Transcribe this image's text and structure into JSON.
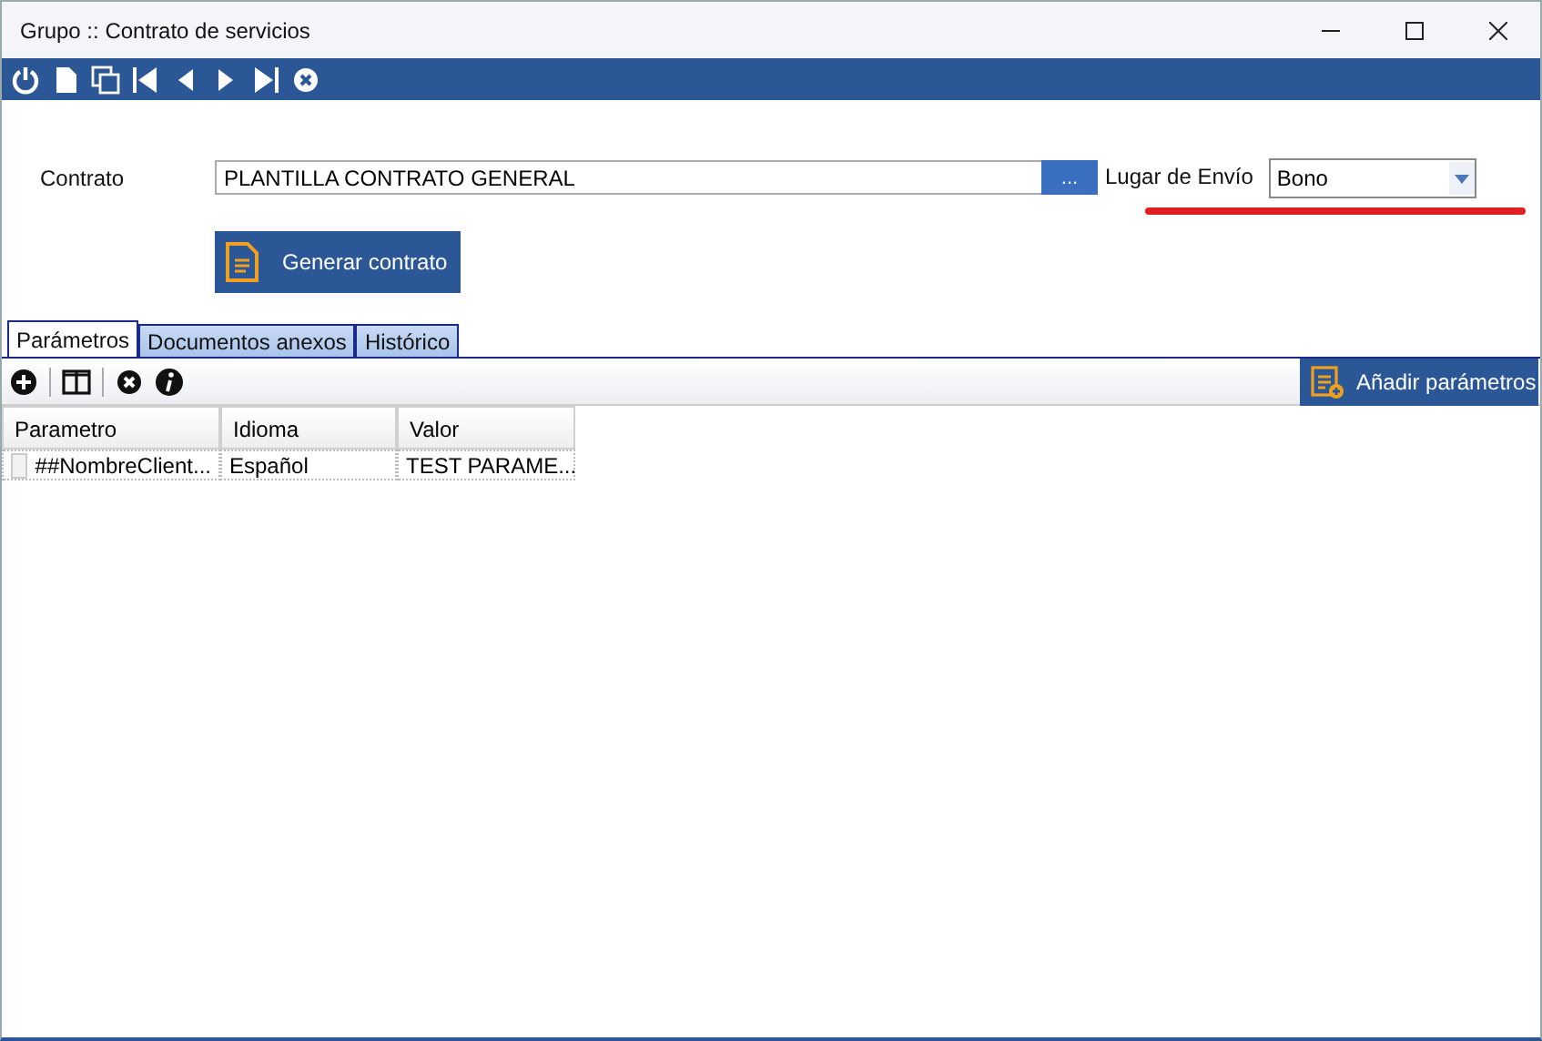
{
  "window": {
    "title": "Grupo :: Contrato de servicios"
  },
  "toolbar": [
    {
      "kind": "power"
    },
    {
      "kind": "new"
    },
    {
      "kind": "copy"
    },
    {
      "kind": "first"
    },
    {
      "kind": "prev"
    },
    {
      "kind": "next"
    },
    {
      "kind": "last"
    },
    {
      "kind": "cancel"
    }
  ],
  "contrato": {
    "label": "Contrato",
    "value": "PLANTILLA CONTRATO GENERAL",
    "browse": "..."
  },
  "generate_button": "Generar contrato",
  "lugar_envio": {
    "label": "Lugar de Envío",
    "value": "Bono",
    "highlighted": true
  },
  "tabs": [
    {
      "label": "Parámetros",
      "selected": true
    },
    {
      "label": "Documentos anexos",
      "selected": false
    },
    {
      "label": "Histórico",
      "selected": false
    }
  ],
  "grid_toolbar": [
    {
      "kind": "add"
    },
    {
      "kind": "columns"
    },
    {
      "kind": "delete"
    },
    {
      "kind": "info"
    }
  ],
  "add_params_button": "Añadir parámetros",
  "table": {
    "columns": [
      "Parametro",
      "Idioma",
      "Valor"
    ],
    "rows": [
      {
        "cells": [
          "##NombreClient...",
          "Español",
          "TEST  PARAME..."
        ]
      }
    ]
  }
}
